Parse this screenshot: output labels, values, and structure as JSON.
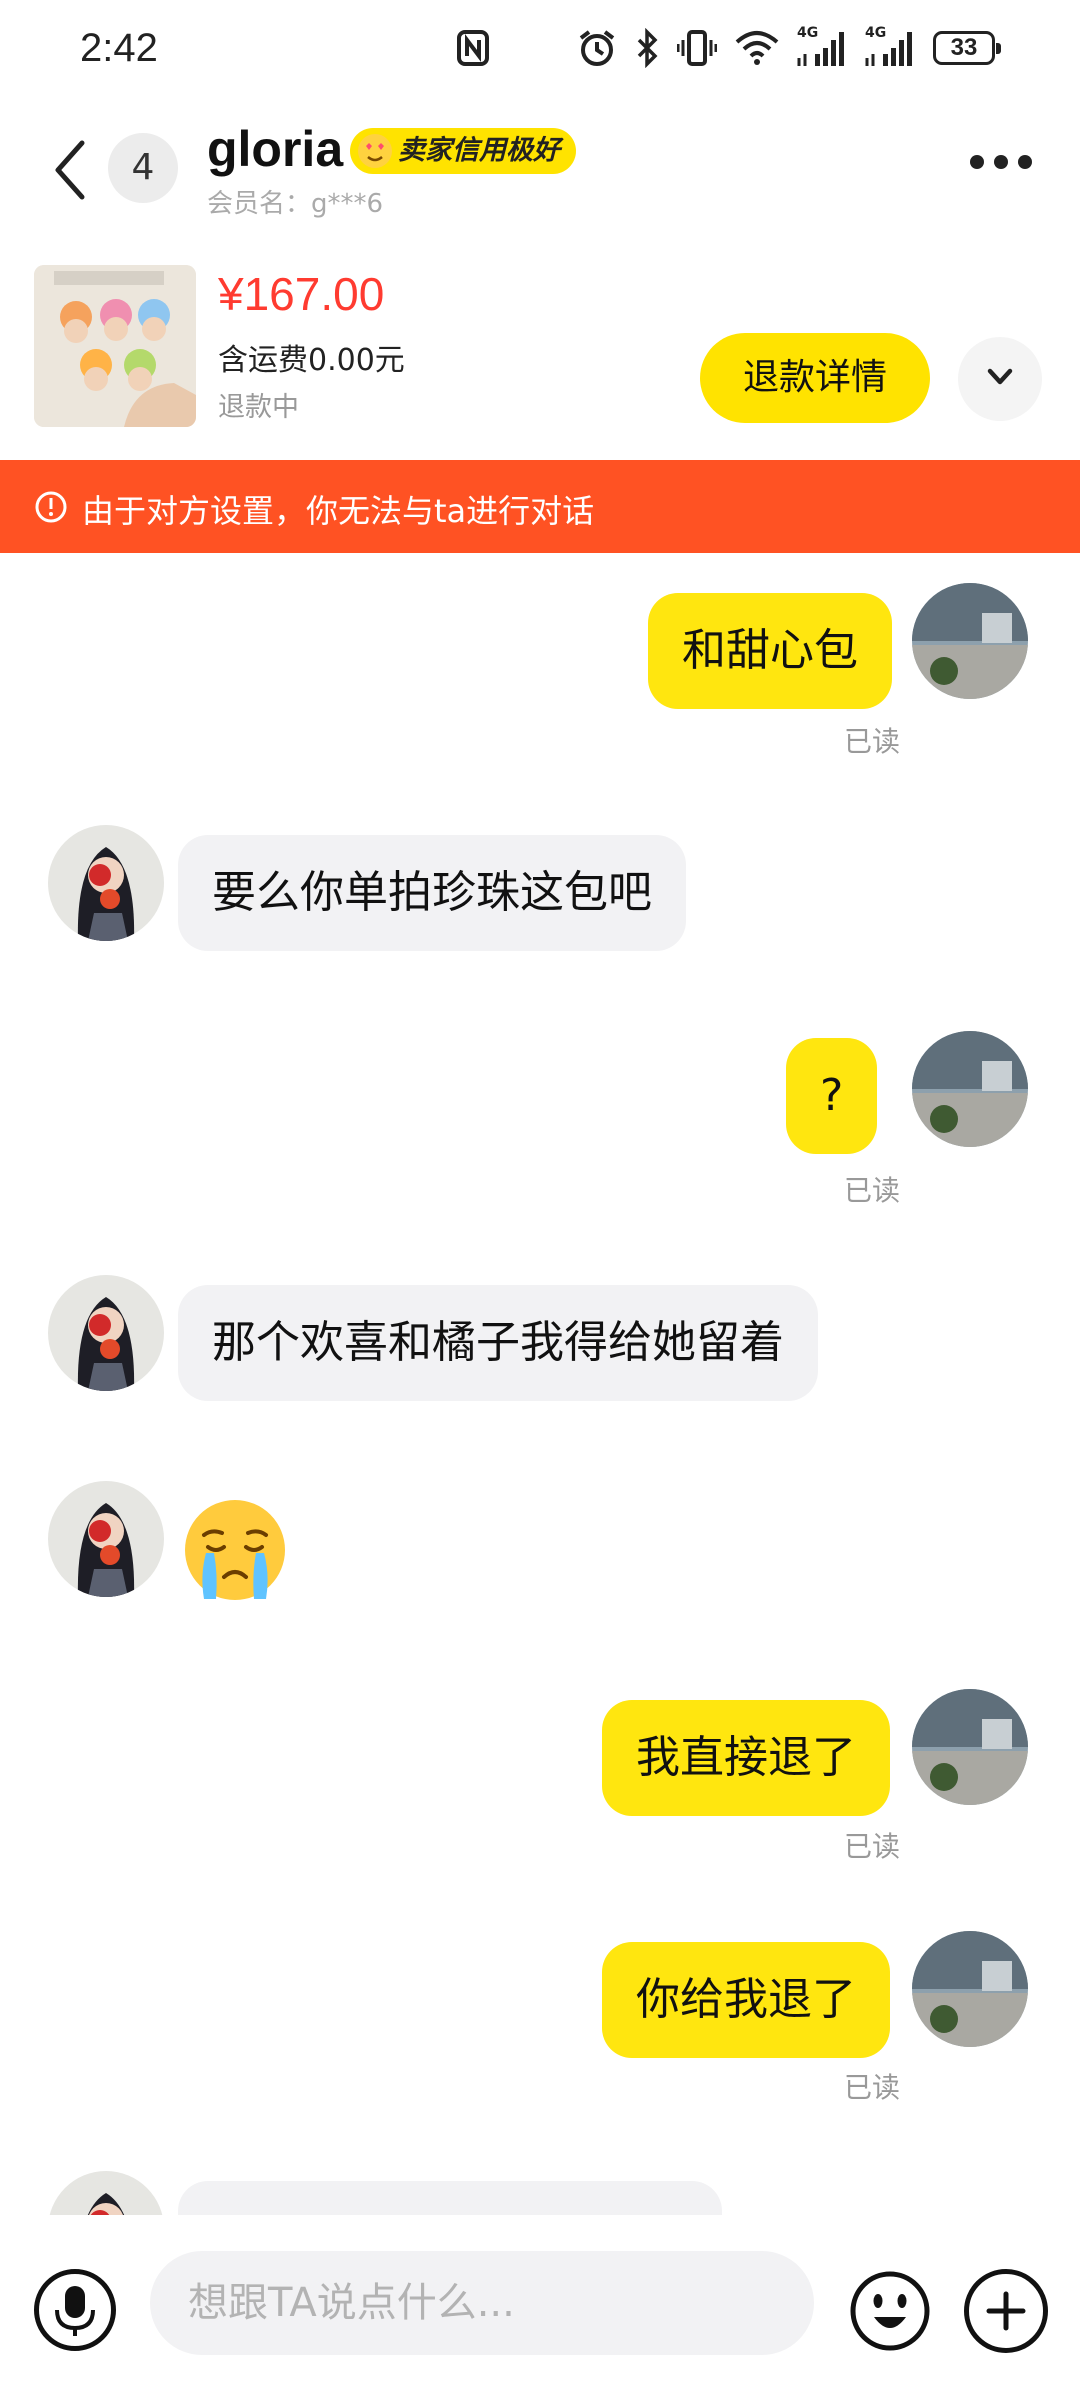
{
  "status_bar": {
    "time": "2:42",
    "network_1": "4G",
    "network_2": "4G",
    "battery": "33"
  },
  "header": {
    "unread_count": "4",
    "name": "gloria",
    "credit_badge": "卖家信用极好",
    "member_id": "会员名：g***6"
  },
  "order": {
    "price": "¥167.00",
    "shipping": "含运费0.00元",
    "status": "退款中",
    "refund_button": "退款详情"
  },
  "warning": {
    "text": "由于对方设置，你无法与ta进行对话"
  },
  "messages": [
    {
      "side": "out",
      "text": "和甜心包",
      "read": "已读"
    },
    {
      "side": "in",
      "text": "要么你单拍珍珠这包吧"
    },
    {
      "side": "out",
      "text": "?",
      "read": "已读"
    },
    {
      "side": "in",
      "text": "那个欢喜和橘子我得给她留着"
    },
    {
      "side": "in",
      "emoji": "crying-face-emoji"
    },
    {
      "side": "out",
      "text": "我直接退了",
      "read": "已读"
    },
    {
      "side": "out",
      "text": "你给我退了",
      "read": "已读"
    }
  ],
  "input": {
    "placeholder": "想跟TA说点什么..."
  },
  "colors": {
    "accent_yellow": "#ffe60f",
    "warning_orange": "#ff5223",
    "price_red": "#ff3b30"
  }
}
